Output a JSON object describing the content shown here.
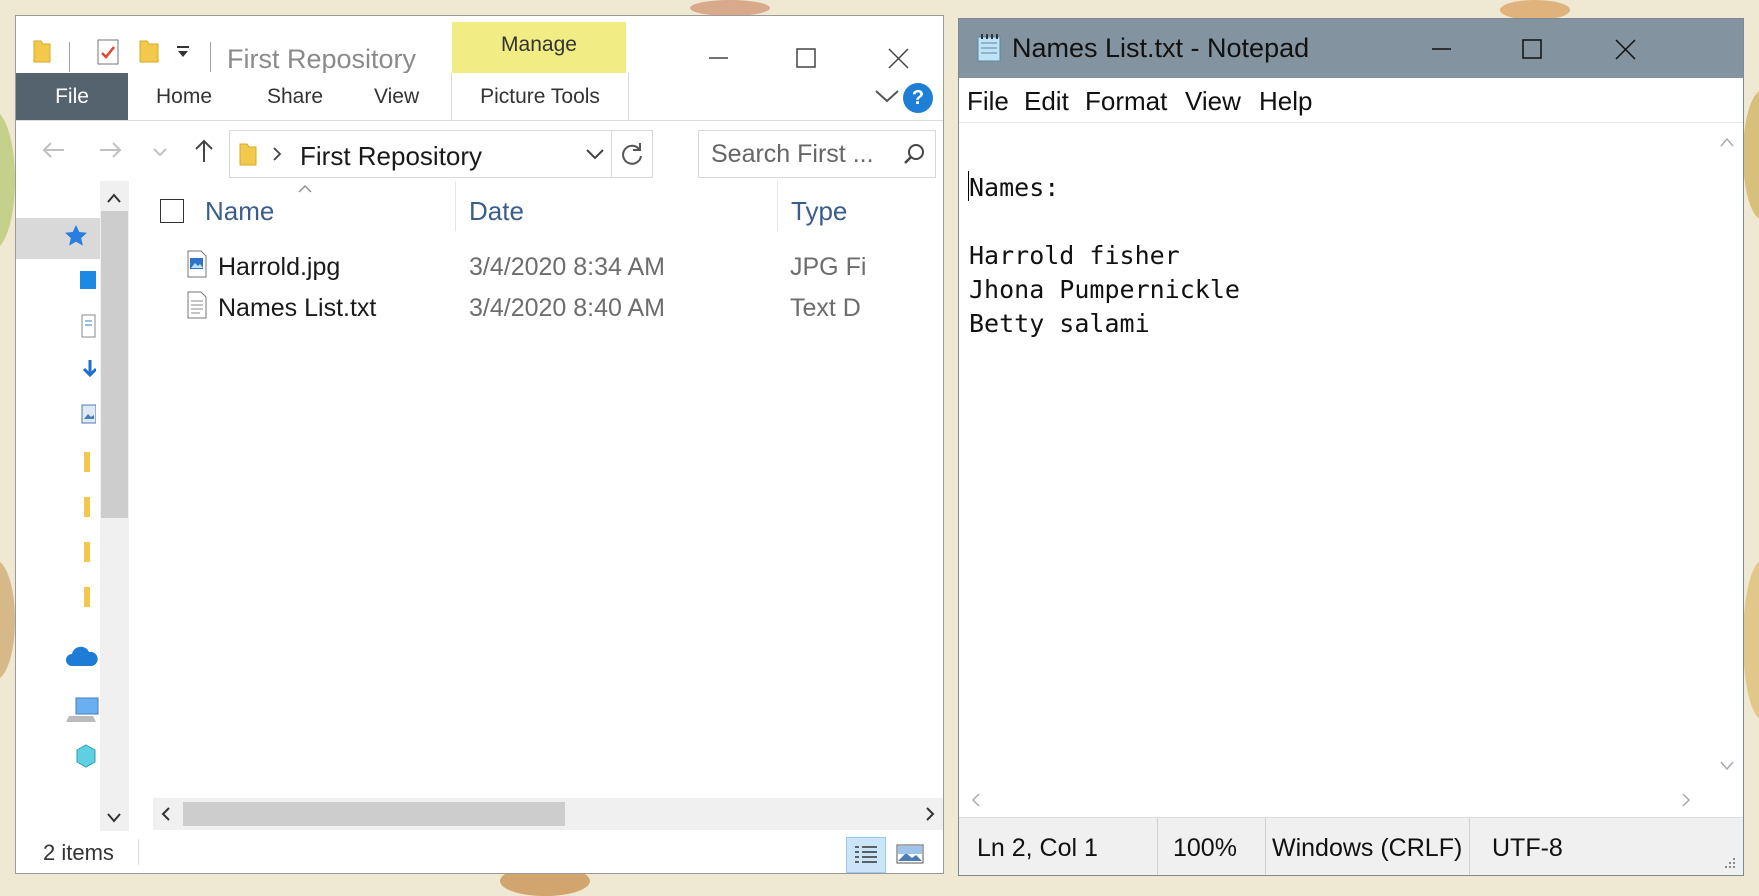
{
  "explorer": {
    "title": "First Repository",
    "manage_tab": "Manage",
    "ribbon": {
      "file_tab": "File",
      "tabs": [
        "Home",
        "Share",
        "View"
      ],
      "picture_tools": "Picture Tools",
      "help_label": "?"
    },
    "address": {
      "path": "First Repository"
    },
    "search": {
      "placeholder": "Search First ..."
    },
    "columns": {
      "name": "Name",
      "date": "Date",
      "type": "Type"
    },
    "files": [
      {
        "name": "Harrold.jpg",
        "date": "3/4/2020 8:34 AM",
        "type": "JPG Fi",
        "icon": "image-file-icon"
      },
      {
        "name": "Names List.txt",
        "date": "3/4/2020 8:40 AM",
        "type": "Text D",
        "icon": "text-file-icon"
      }
    ],
    "status": {
      "item_count": "2 items"
    },
    "colors": {
      "manage_tab": "#f1ec84",
      "file_tab": "#55636f",
      "column_header_text": "#3a5d8c",
      "help": "#1e7fd6"
    }
  },
  "notepad": {
    "title": "Names List.txt - Notepad",
    "menu": [
      "File",
      "Edit",
      "Format",
      "View",
      "Help"
    ],
    "content_lines": [
      "Names:",
      "",
      "Harrold fisher",
      "Jhona Pumpernickle",
      "Betty salami"
    ],
    "status": {
      "position": "Ln 2, Col 1",
      "zoom": "100%",
      "line_ending": "Windows (CRLF)",
      "encoding": "UTF-8"
    },
    "colors": {
      "title_bar": "#83939f"
    }
  }
}
